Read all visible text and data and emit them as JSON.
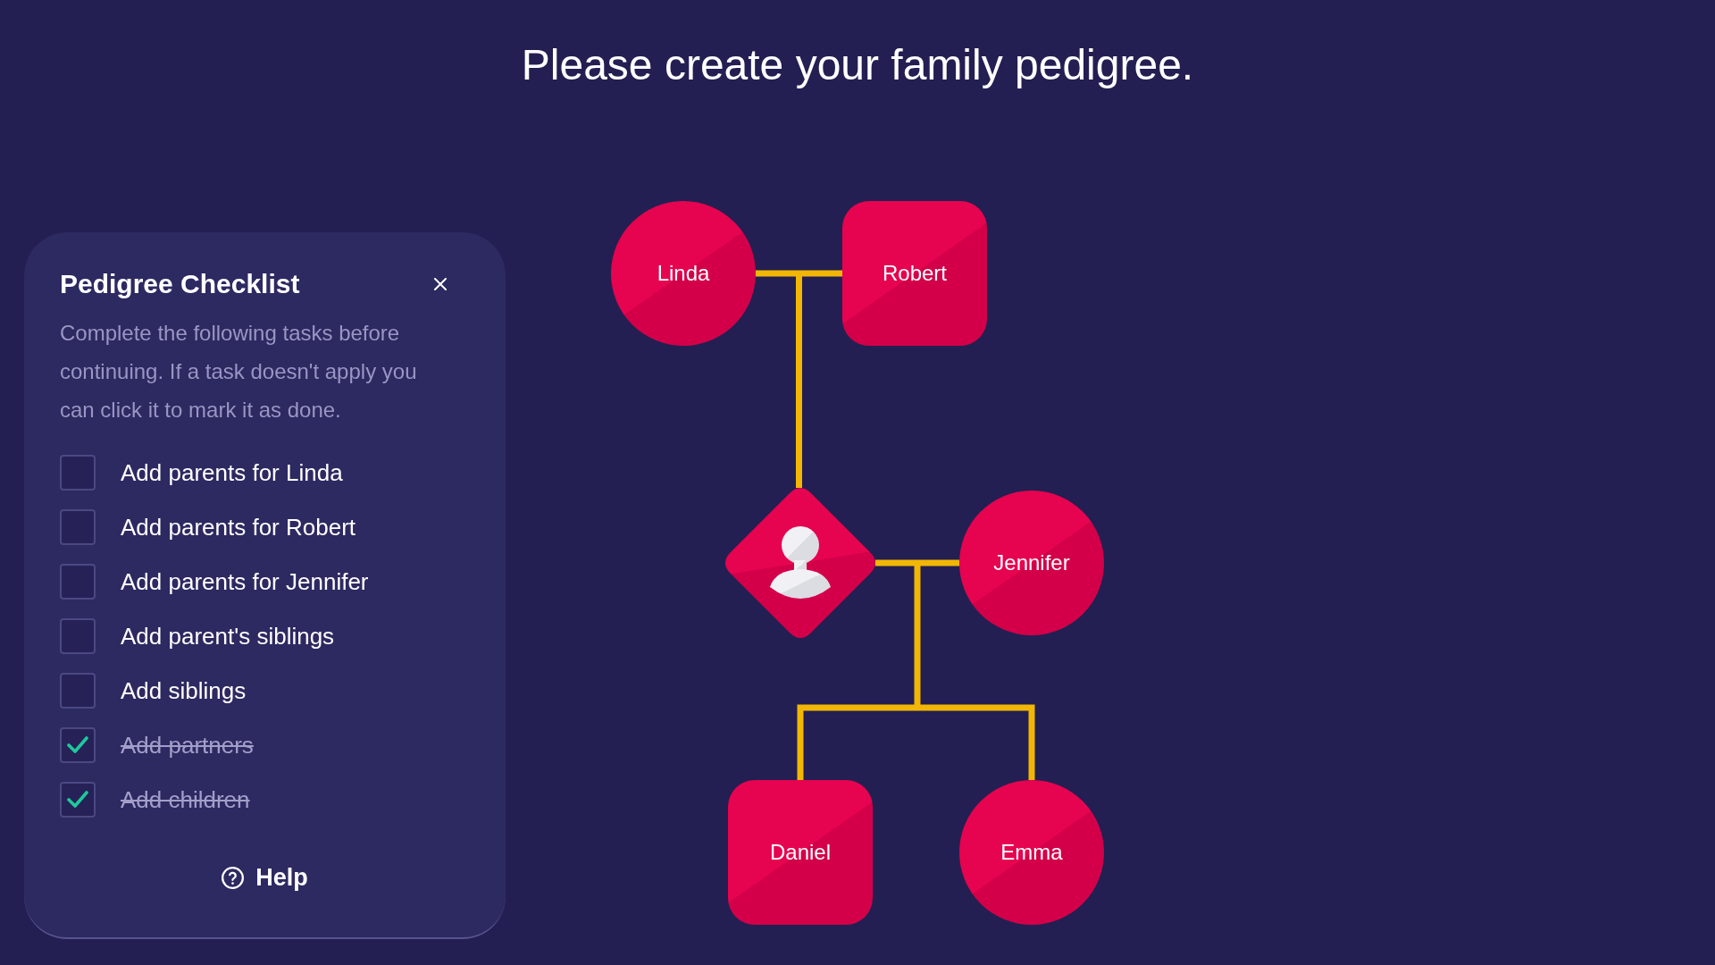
{
  "title": "Please create your family pedigree.",
  "checklist": {
    "title": "Pedigree Checklist",
    "description": "Complete the following tasks before continuing. If a task doesn't apply you can click it to mark it as done.",
    "tasks": [
      {
        "label": "Add parents for Linda",
        "checked": false
      },
      {
        "label": "Add parents for Robert",
        "checked": false
      },
      {
        "label": "Add parents for Jennifer",
        "checked": false
      },
      {
        "label": "Add parent's siblings",
        "checked": false
      },
      {
        "label": "Add siblings",
        "checked": false
      },
      {
        "label": "Add partners",
        "checked": true
      },
      {
        "label": "Add children",
        "checked": true
      }
    ],
    "help": "Help"
  },
  "pedigree": {
    "generations": [
      [
        {
          "kind": "circle",
          "name": "Linda"
        },
        {
          "kind": "square",
          "name": "Robert"
        }
      ],
      [
        {
          "kind": "diamond"
        },
        {
          "kind": "circle",
          "name": "Jennifer"
        }
      ],
      [
        {
          "kind": "square",
          "name": "Daniel"
        },
        {
          "kind": "circle",
          "name": "Emma"
        }
      ]
    ]
  }
}
